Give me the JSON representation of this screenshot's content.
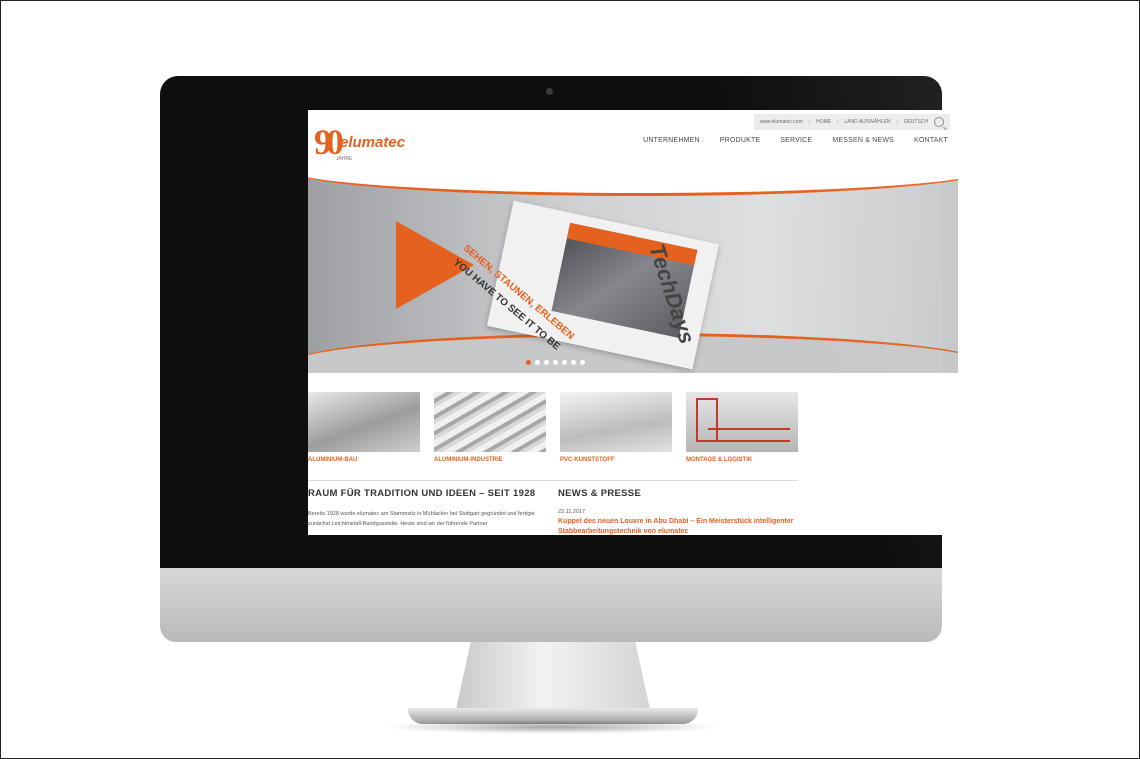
{
  "website": {
    "topbar": {
      "url": "www.elumatec.com",
      "links": [
        "HOME",
        "LAND AUSWÄHLEN",
        "DEUTSCH"
      ]
    },
    "logo": {
      "number": "90",
      "brand": "elumatec",
      "subtitle": "JAHRE"
    },
    "nav": [
      "UNTERNEHMEN",
      "PRODUKTE",
      "SERVICE",
      "MESSEN & NEWS",
      "KONTAKT"
    ],
    "hero": {
      "headline_top": "SEHEN, STAUNEN, ERLEBEN",
      "headline_bottom": "YOU HAVE TO SEE IT TO BE",
      "brand_title": "TechDays",
      "slides": 7,
      "active_slide": 1
    },
    "categories": [
      {
        "label": "ALUMINIUM-BAU"
      },
      {
        "label": "ALUMINIUM-INDUSTRIE"
      },
      {
        "label": "PVC-KUNSTSTOFF"
      },
      {
        "label": "MONTAGE & LOGISTIK"
      }
    ],
    "about": {
      "heading": "RAUM FÜR TRADITION UND IDEEN – SEIT 1928",
      "text": "Bereits 1928 wurde elumatec am Stammsitz in Mühlacker bei Stuttgart gegründet und fertigte zunächst Leichtmetall-Bandgussteile. Heute sind wir der führende Partner"
    },
    "news": {
      "heading": "NEWS & PRESSE",
      "date": "22.11.2017",
      "title": "Kuppel des neuen Louvre in Abu Dhabi – Ein Meisterstück intelligenter Stabbearbeitungstechnik von elumatec"
    }
  },
  "colors": {
    "accent": "#e5611f",
    "bezel": "#0e0e0e"
  }
}
